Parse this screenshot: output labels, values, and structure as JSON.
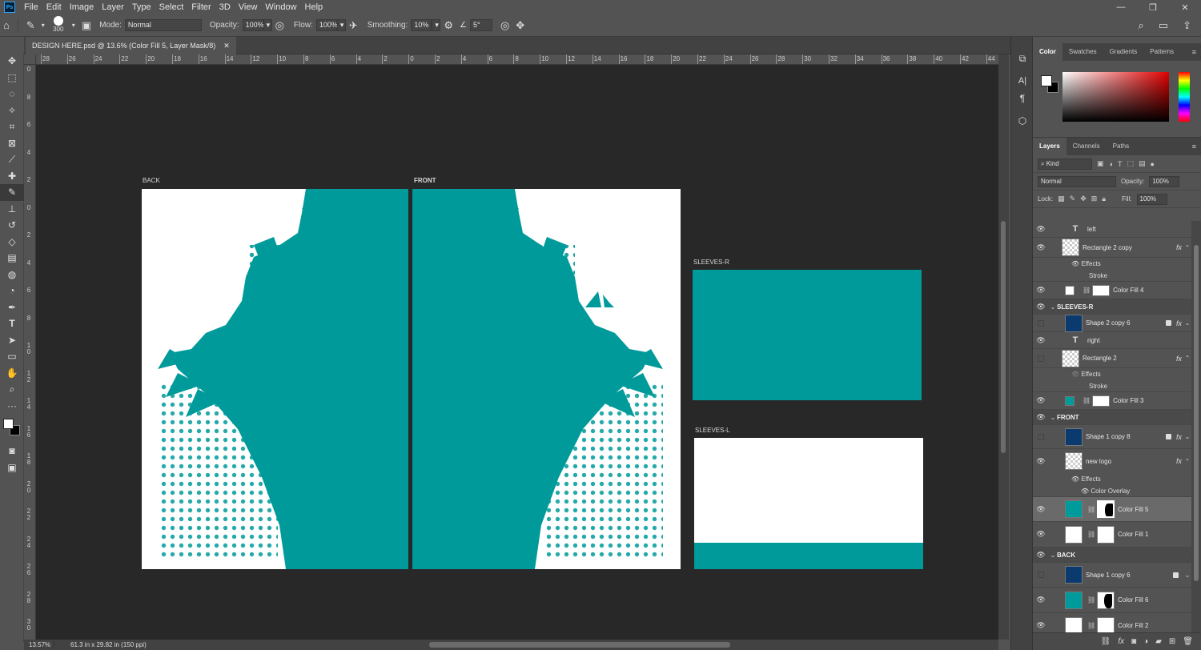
{
  "menubar": {
    "logo": "Ps",
    "items": [
      "File",
      "Edit",
      "Image",
      "Layer",
      "Type",
      "Select",
      "Filter",
      "3D",
      "View",
      "Window",
      "Help"
    ],
    "window_controls": [
      "—",
      "❐",
      "✕"
    ]
  },
  "options_bar": {
    "brush_size": "300",
    "mode_label": "Mode:",
    "mode_value": "Normal",
    "opacity_label": "Opacity:",
    "opacity_value": "100%",
    "flow_label": "Flow:",
    "flow_value": "100%",
    "smoothing_label": "Smoothing:",
    "smoothing_value": "10%",
    "angle_value": "5°"
  },
  "document": {
    "tab_title": "DESIGN HERE.psd @ 13.6% (Color Fill 5, Layer Mask/8)",
    "zoom": "13.57%",
    "doc_size": "61.3 in x 29.82 in (150 ppi)"
  },
  "rulers": {
    "h_labels": [
      "28",
      "26",
      "24",
      "22",
      "20",
      "18",
      "16",
      "14",
      "12",
      "10",
      "8",
      "6",
      "4",
      "2",
      "0",
      "2",
      "4",
      "6",
      "8",
      "10",
      "12",
      "14",
      "16",
      "18",
      "20",
      "22",
      "24",
      "26",
      "28",
      "30",
      "32",
      "34",
      "36",
      "38",
      "40",
      "42",
      "44"
    ],
    "v_labels": [
      "0",
      "8",
      "6",
      "4",
      "2",
      "0",
      "2",
      "4",
      "6",
      "8",
      "10",
      "12",
      "14",
      "16",
      "18",
      "20",
      "22",
      "24",
      "26",
      "28",
      "30"
    ]
  },
  "artboards": {
    "back_label": "BACK",
    "front_label": "FRONT",
    "sleeves_r_label": "SLEEVES-R",
    "sleeves_l_label": "SLEEVES-L",
    "teal": "#009a9a"
  },
  "panels": {
    "color_tabs": [
      "Color",
      "Swatches",
      "Gradients",
      "Patterns"
    ],
    "layers_tabs": [
      "Layers",
      "Channels",
      "Paths"
    ],
    "filter_kind": "Kind",
    "blend_mode": "Normal",
    "opacity_label": "Opacity:",
    "opacity_value": "100%",
    "lock_label": "Lock:",
    "fill_label": "Fill:",
    "fill_value": "100%"
  },
  "layers": {
    "left": "left",
    "rect2copy": "Rectangle 2 copy",
    "effects": "Effects",
    "stroke": "Stroke",
    "colorfill4": "Color Fill 4",
    "group_sleeves_r": "SLEEVES-R",
    "shape2copy6": "Shape 2 copy 6",
    "right": "right",
    "rect2": "Rectangle 2",
    "colorfill3": "Color Fill 3",
    "group_front": "FRONT",
    "shape1copy8": "Shape 1 copy 8",
    "newlogo": "new logo",
    "color_overlay": "Color Overlay",
    "colorfill5": "Color Fill 5",
    "colorfill1": "Color Fill 1",
    "group_back": "BACK",
    "shape1copy6": "Shape 1 copy 6",
    "colorfill6": "Color Fill 6",
    "colorfill2": "Color Fill 2"
  }
}
